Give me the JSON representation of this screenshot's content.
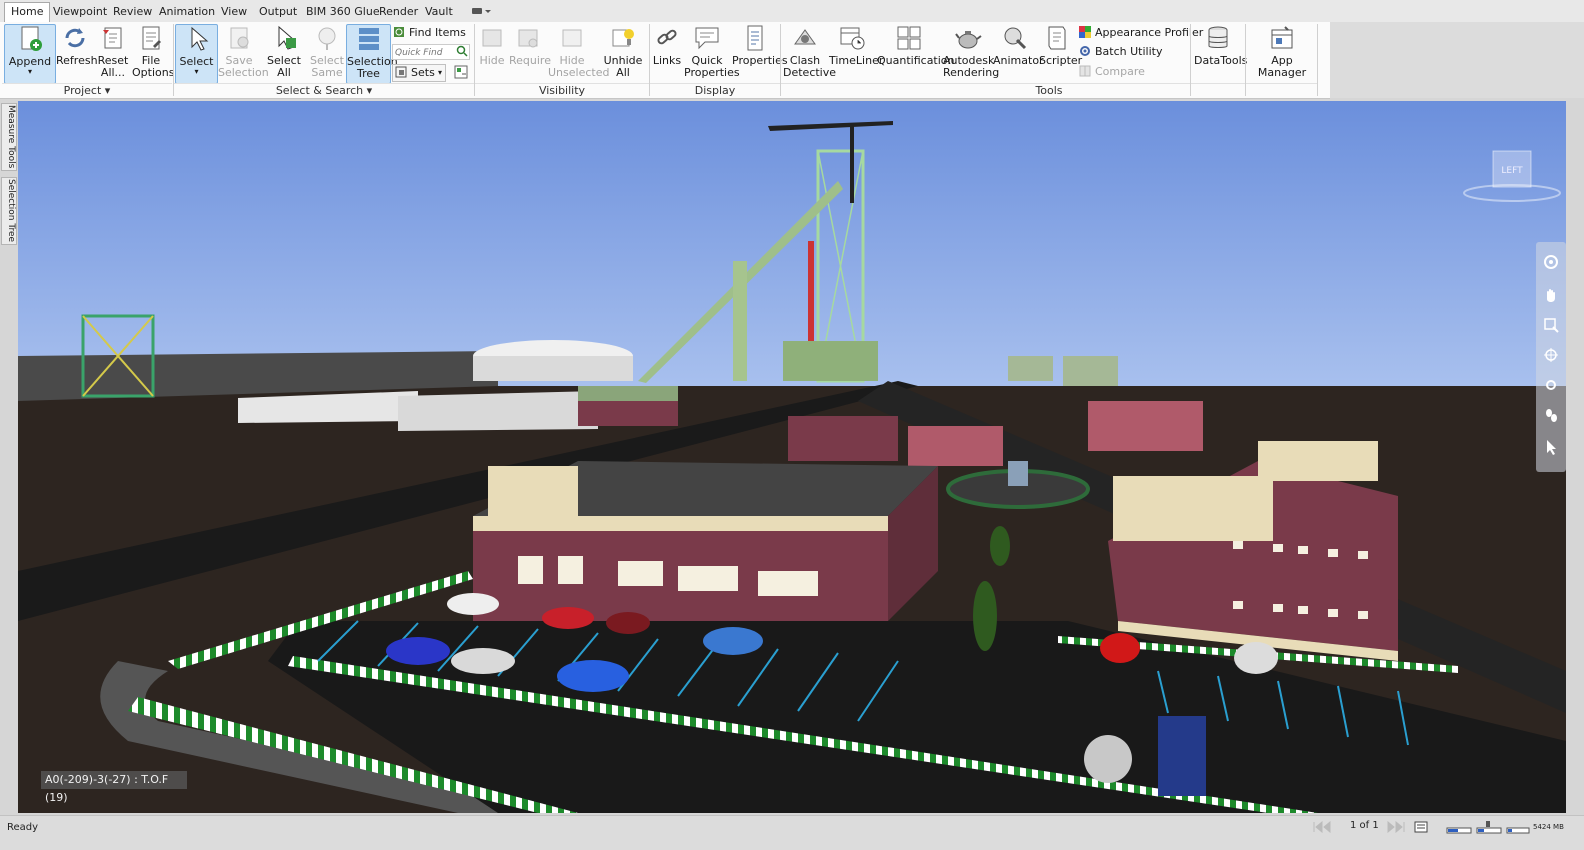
{
  "tabs": [
    "Home",
    "Viewpoint",
    "Review",
    "Animation",
    "View",
    "Output",
    "BIM 360 Glue",
    "Render",
    "Vault"
  ],
  "ribbon": {
    "project": {
      "append": "Append",
      "refresh": "Refresh",
      "reset_1": "Reset",
      "reset_2": "All...",
      "file_1": "File",
      "file_2": "Options",
      "group": "Project"
    },
    "select_search": {
      "select": "Select",
      "save_1": "Save",
      "save_2": "Selection",
      "selall_1": "Select",
      "selall_2": "All",
      "selsame_1": "Select",
      "selsame_2": "Same",
      "seltree_1": "Selection",
      "seltree_2": "Tree",
      "find_items": "Find Items",
      "quick_find_placeholder": "Quick Find",
      "sets": "Sets",
      "group": "Select & Search"
    },
    "visibility": {
      "hide": "Hide",
      "require": "Require",
      "hideuns_1": "Hide",
      "hideuns_2": "Unselected",
      "unhide_1": "Unhide",
      "unhide_2": "All",
      "group": "Visibility"
    },
    "display": {
      "links": "Links",
      "qp_1": "Quick",
      "qp_2": "Properties",
      "properties": "Properties",
      "group": "Display"
    },
    "tools": {
      "clash_1": "Clash",
      "clash_2": "Detective",
      "timeliner": "TimeLiner",
      "quantification": "Quantification",
      "ar_1": "Autodesk",
      "ar_2": "Rendering",
      "animator": "Animator",
      "scripter": "Scripter",
      "appearance_profiler": "Appearance Profiler",
      "batch_utility": "Batch Utility",
      "compare": "Compare",
      "group": "Tools"
    },
    "datatools": "DataTools",
    "app_manager": "App Manager"
  },
  "side_tabs": [
    "Measure Tools",
    "Selection Tree"
  ],
  "viewcube_label": "LEFT",
  "coordinates": "A0(-209)-3(-27) : T.O.F (19)",
  "status": {
    "ready": "Ready",
    "page": "1 of 1",
    "memory": "5424 MB"
  },
  "colors": {
    "sky_top": "#6b8fdc",
    "sky_bottom": "#a8c0ee",
    "ground": "#2d2520",
    "accent_select": "#cde4f7",
    "wall_tan": "#e8dcb8",
    "wall_maroon": "#7a3a4a"
  }
}
